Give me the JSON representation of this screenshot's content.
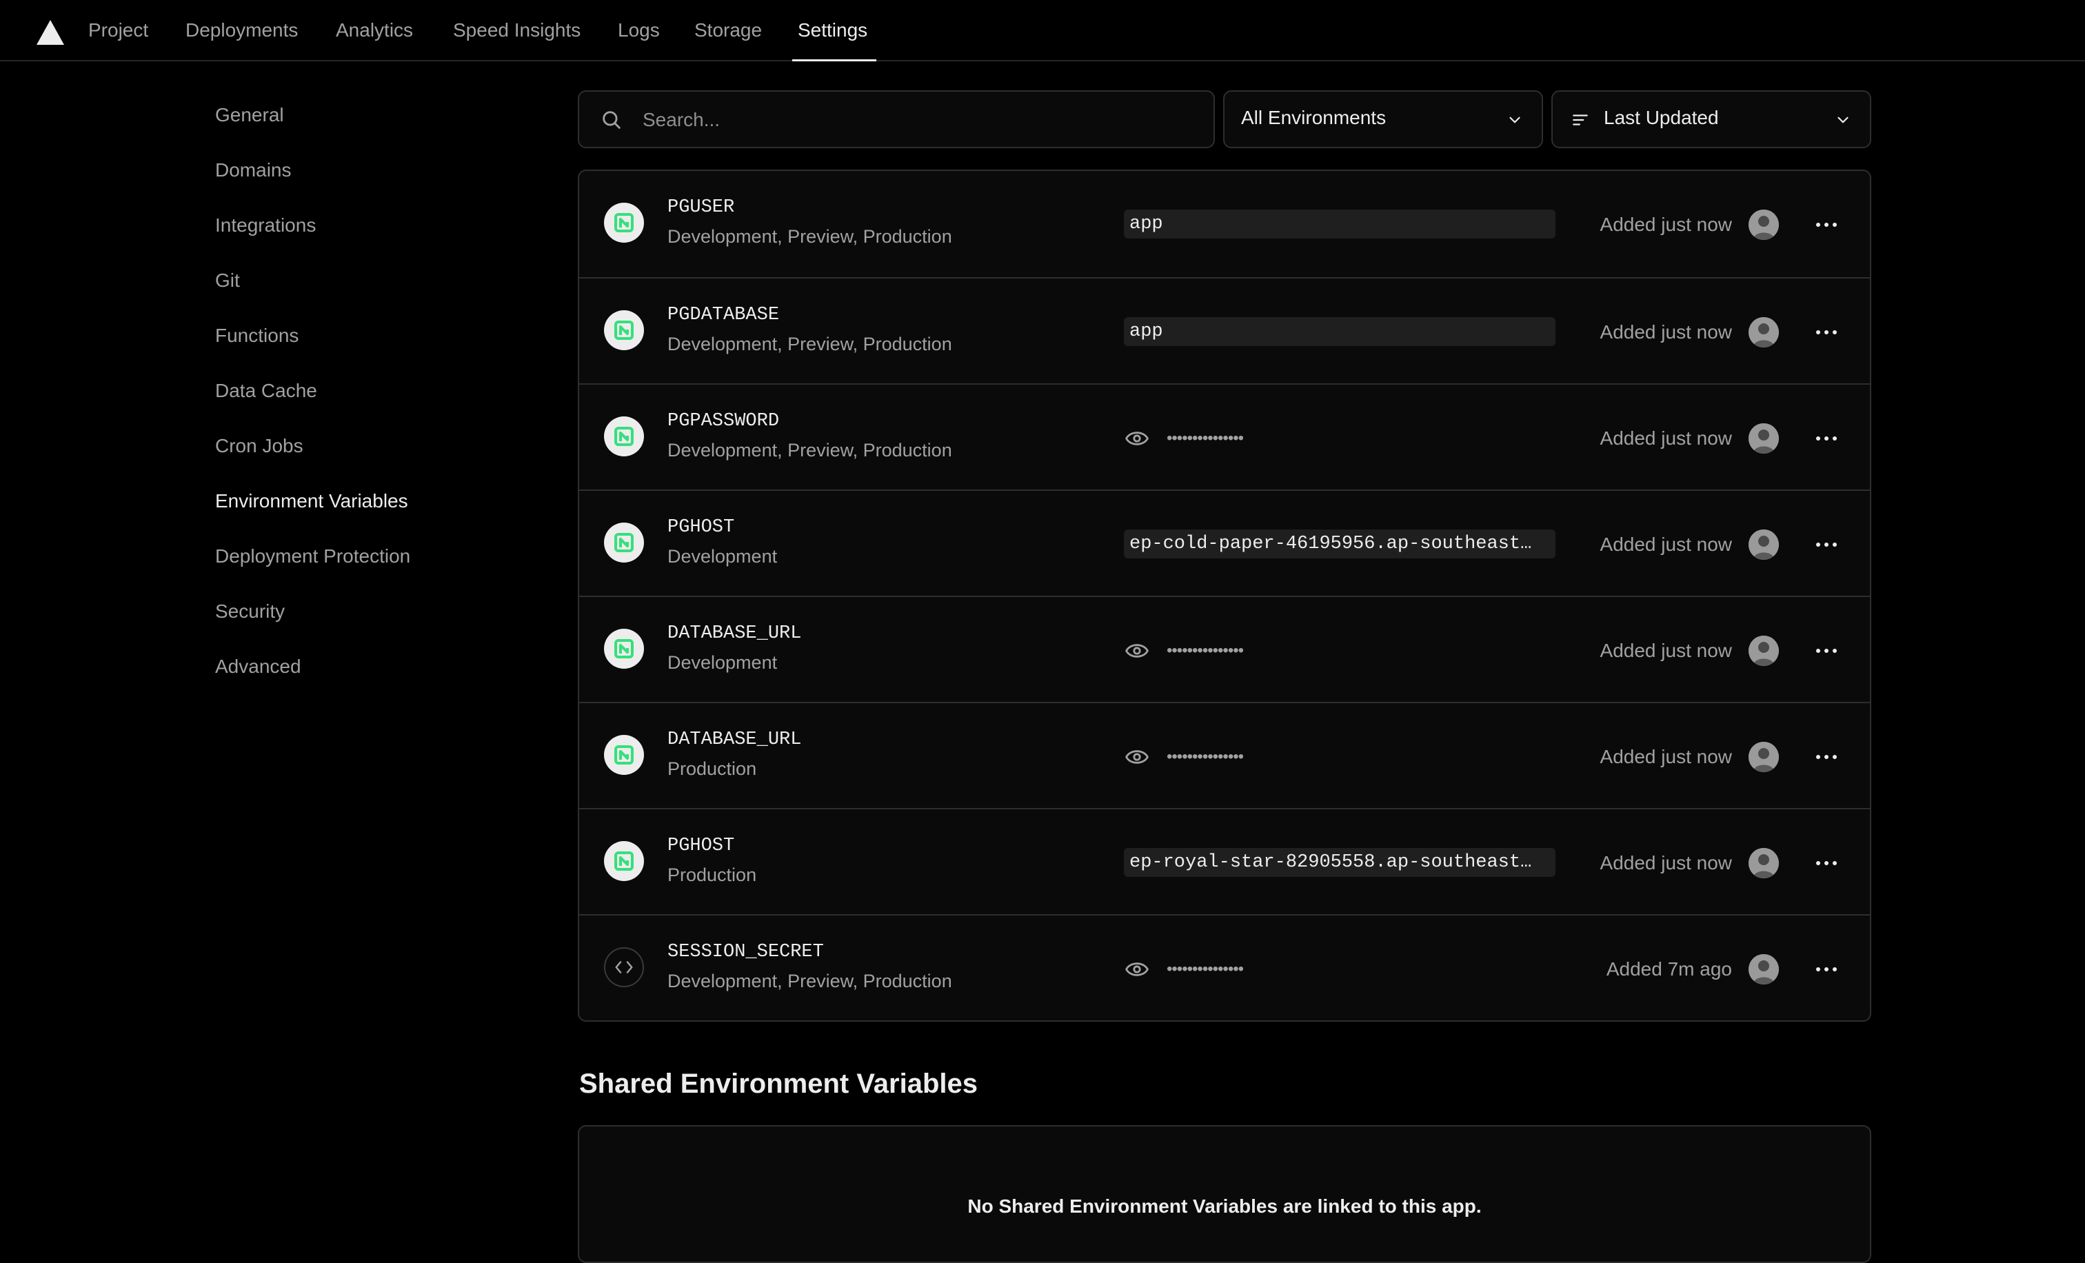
{
  "nav": {
    "tabs": [
      {
        "label": "Project"
      },
      {
        "label": "Deployments"
      },
      {
        "label": "Analytics"
      },
      {
        "label": "Speed Insights"
      },
      {
        "label": "Logs"
      },
      {
        "label": "Storage"
      },
      {
        "label": "Settings",
        "active": true
      }
    ]
  },
  "sidebar": {
    "items": [
      {
        "label": "General"
      },
      {
        "label": "Domains"
      },
      {
        "label": "Integrations"
      },
      {
        "label": "Git"
      },
      {
        "label": "Functions"
      },
      {
        "label": "Data Cache"
      },
      {
        "label": "Cron Jobs"
      },
      {
        "label": "Environment Variables",
        "active": true
      },
      {
        "label": "Deployment Protection"
      },
      {
        "label": "Security"
      },
      {
        "label": "Advanced"
      }
    ]
  },
  "toolbar": {
    "search_placeholder": "Search...",
    "environment_filter": "All Environments",
    "sort": "Last Updated"
  },
  "env_vars": [
    {
      "icon": "neon-icon",
      "name": "PGUSER",
      "environments": "Development, Preview, Production",
      "value": "app",
      "hidden": false,
      "added": "Added just now"
    },
    {
      "icon": "neon-icon",
      "name": "PGDATABASE",
      "environments": "Development, Preview, Production",
      "value": "app",
      "hidden": false,
      "added": "Added just now"
    },
    {
      "icon": "neon-icon",
      "name": "PGPASSWORD",
      "environments": "Development, Preview, Production",
      "value": "•••••••••••••••",
      "hidden": true,
      "added": "Added just now"
    },
    {
      "icon": "neon-icon",
      "name": "PGHOST",
      "environments": "Development",
      "value": "ep-cold-paper-46195956.ap-southeast…",
      "hidden": false,
      "added": "Added just now"
    },
    {
      "icon": "neon-icon",
      "name": "DATABASE_URL",
      "environments": "Development",
      "value": "•••••••••••••••",
      "hidden": true,
      "added": "Added just now"
    },
    {
      "icon": "neon-icon",
      "name": "DATABASE_URL",
      "environments": "Production",
      "value": "•••••••••••••••",
      "hidden": true,
      "added": "Added just now"
    },
    {
      "icon": "neon-icon",
      "name": "PGHOST",
      "environments": "Production",
      "value": "ep-royal-star-82905558.ap-southeast…",
      "hidden": false,
      "added": "Added just now"
    },
    {
      "icon": "code-icon",
      "name": "SESSION_SECRET",
      "environments": "Development, Preview, Production",
      "value": "•••••••••••••••",
      "hidden": true,
      "added": "Added 7m ago"
    }
  ],
  "shared": {
    "title": "Shared Environment Variables",
    "empty_message": "No Shared Environment Variables are linked to this app."
  },
  "colors": {
    "background": "#000000",
    "neon_green": "#35e07c"
  }
}
